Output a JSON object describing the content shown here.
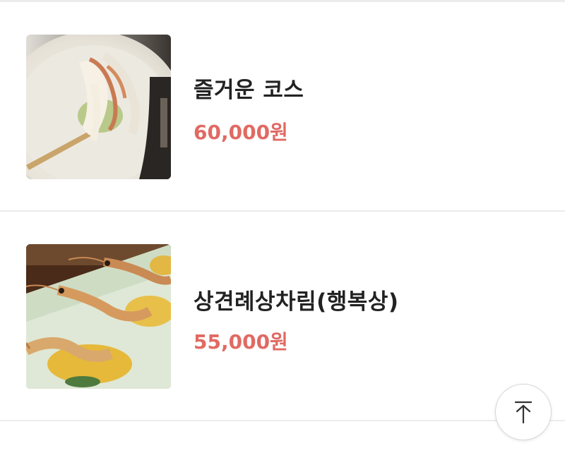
{
  "menu": {
    "items": [
      {
        "name": "즐거운 코스",
        "price": "60,000원",
        "image_icon": "dish-photo-icon"
      },
      {
        "name": "상견례상차림(행복상)",
        "price": "55,000원",
        "image_icon": "shrimp-photo-icon"
      }
    ]
  },
  "scroll_top": {
    "icon": "arrow-up-to-top-icon"
  },
  "colors": {
    "price": "#e06a63",
    "name": "#222222",
    "divider": "#ececec"
  }
}
